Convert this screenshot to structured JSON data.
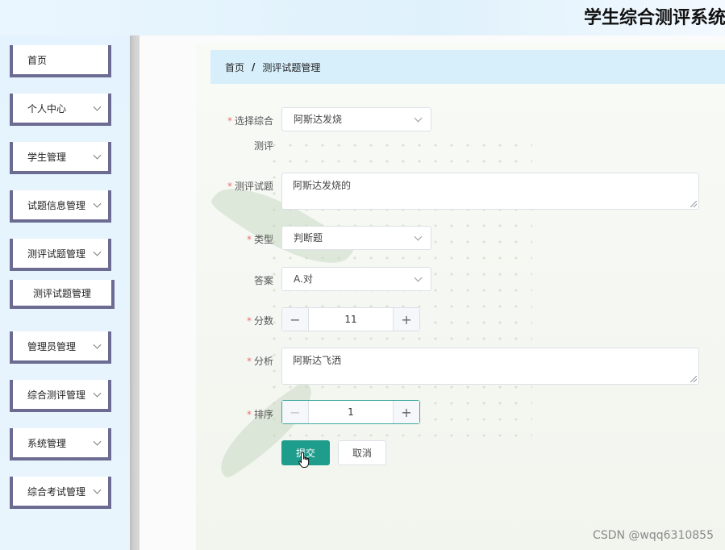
{
  "app": {
    "title": "学生综合测评系统"
  },
  "sidebar": {
    "items": [
      {
        "label": "首页",
        "has_arrow": false
      },
      {
        "label": "个人中心",
        "has_arrow": true
      },
      {
        "label": "学生管理",
        "has_arrow": true
      },
      {
        "label": "试题信息管理",
        "has_arrow": true
      },
      {
        "label": "测评试题管理",
        "has_arrow": true
      },
      {
        "label": "管理员管理",
        "has_arrow": true
      },
      {
        "label": "综合测评管理",
        "has_arrow": true
      },
      {
        "label": "系统管理",
        "has_arrow": true
      },
      {
        "label": "综合考试管理",
        "has_arrow": true
      }
    ],
    "submenu": {
      "label": "测评试题管理"
    }
  },
  "breadcrumb": {
    "home": "首页",
    "separator": "/",
    "current": "测评试题管理"
  },
  "form": {
    "select_eval": {
      "label_line1": "选择综合",
      "label_line2": "测评",
      "value": "阿斯达发烧"
    },
    "question": {
      "label": "测评试题",
      "value": "阿斯达发烧的"
    },
    "type": {
      "label": "类型",
      "value": "判断题"
    },
    "answer": {
      "label": "答案",
      "value": "A.对"
    },
    "score": {
      "label": "分数",
      "value": "11",
      "minus": "−",
      "plus": "+"
    },
    "analysis": {
      "label": "分析",
      "value": "阿斯达飞洒"
    },
    "order": {
      "label": "排序",
      "value": "1",
      "minus": "−",
      "plus": "+"
    },
    "required_mark": "*",
    "submit_label": "提交",
    "cancel_label": "取消"
  },
  "watermark": "CSDN @wqq6310855",
  "colors": {
    "primary": "#1e9c8c",
    "required": "#f56c6c",
    "breadcrumb_bg": "#d7eefb"
  }
}
